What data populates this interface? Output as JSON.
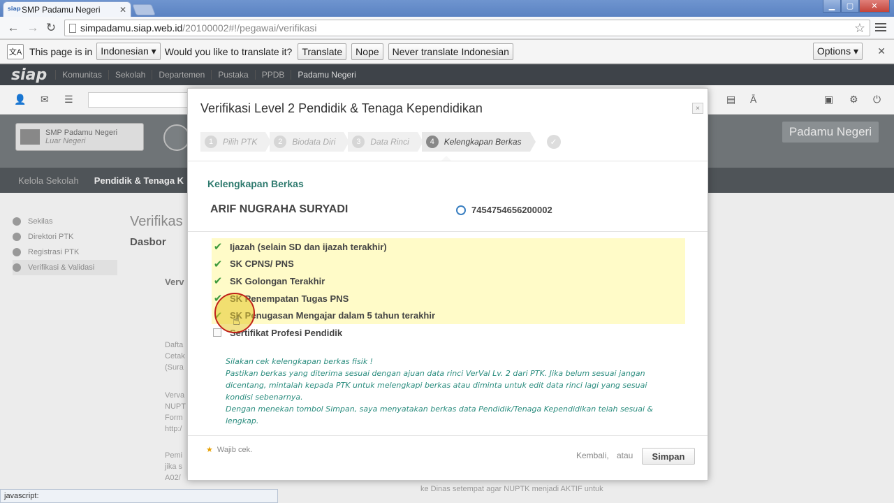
{
  "browser": {
    "tab_title": "SMP Padamu Negeri",
    "tab_favicon": "siap",
    "tab_close": "✕",
    "url_host": "simpadamu.siap.web.id",
    "url_path": "/20100002#!/pegawai/verifikasi"
  },
  "translate_bar": {
    "prefix": "This page is in",
    "language": "Indonesian ▾",
    "question": "Would you like to translate it?",
    "translate": "Translate",
    "nope": "Nope",
    "never": "Never translate Indonesian",
    "options": "Options ▾",
    "close": "✕"
  },
  "site_nav": {
    "logo": "siap",
    "items": [
      "Komunitas",
      "Sekolah",
      "Departemen",
      "Pustaka",
      "PPDB",
      "Padamu Negeri"
    ]
  },
  "school": {
    "name": "SMP Padamu Negeri",
    "sub": "Luar Negeri"
  },
  "badge": "Padamu Negeri",
  "subnav": {
    "item1": "Kelola Sekolah",
    "item2": "Pendidik & Tenaga K"
  },
  "sidebar": {
    "items": [
      "Sekilas",
      "Direktori PTK",
      "Registrasi PTK",
      "Verifikasi & Validasi"
    ]
  },
  "content": {
    "title": "Verifikas",
    "subtitle": "Dasbor",
    "line_a": "Verv",
    "block1": [
      "Dafta",
      "Cetak",
      "(Sura"
    ],
    "block2": [
      "Verva",
      "NUPT",
      "Form",
      "http:/"
    ],
    "block3": [
      "Pemi",
      "jika s",
      "A02/"
    ],
    "footer": "ke Dinas setempat agar NUPTK menjadi AKTIF untuk"
  },
  "status_bar": "javascript:",
  "modal": {
    "title": "Verifikasi Level 2 Pendidik & Tenaga Kependidikan",
    "close": "×",
    "steps": [
      {
        "num": "1",
        "label": "Pilih PTK"
      },
      {
        "num": "2",
        "label": "Biodata Diri"
      },
      {
        "num": "3",
        "label": "Data Rinci"
      },
      {
        "num": "4",
        "label": "Kelengkapan Berkas"
      }
    ],
    "step_done": "✓",
    "section_title": "Kelengkapan Berkas",
    "person_name": "ARIF NUGRAHA SURYADI",
    "nuptk": "7454754656200002",
    "checklist": [
      {
        "label": "Ijazah (selain SD dan ijazah terakhir)",
        "checked": true
      },
      {
        "label": "SK CPNS/ PNS",
        "checked": true
      },
      {
        "label": "SK Golongan Terakhir",
        "checked": true
      },
      {
        "label": "SK Penempatan Tugas PNS",
        "checked": true
      },
      {
        "label": "SK Penugasan Mengajar dalam 5 tahun terakhir",
        "checked": true
      },
      {
        "label": "Sertifikat Profesi Pendidik",
        "checked": false
      }
    ],
    "notice": [
      "Silakan cek kelengkapan berkas fisik !",
      "Pastikan berkas yang diterima sesuai dengan ajuan data rinci VerVal Lv. 2 dari PTK. Jika belum sesuai jangan dicentang, mintalah kepada PTK untuk melengkapi berkas atau diminta untuk edit data rinci lagi yang sesuai kondisi sebenarnya.",
      "Dengan menekan tombol Simpan, saya menyatakan berkas data Pendidik/Tenaga Kependidikan telah sesuai & lengkap."
    ],
    "wajib": "Wajib cek.",
    "back": "Kembali,",
    "or": "atau",
    "save": "Simpan"
  },
  "colors": {
    "accent_teal": "#2e7a6e",
    "highlight_yellow": "#fffbc8",
    "check_green": "#3d9a3d",
    "nav_dark": "#3e4349"
  }
}
